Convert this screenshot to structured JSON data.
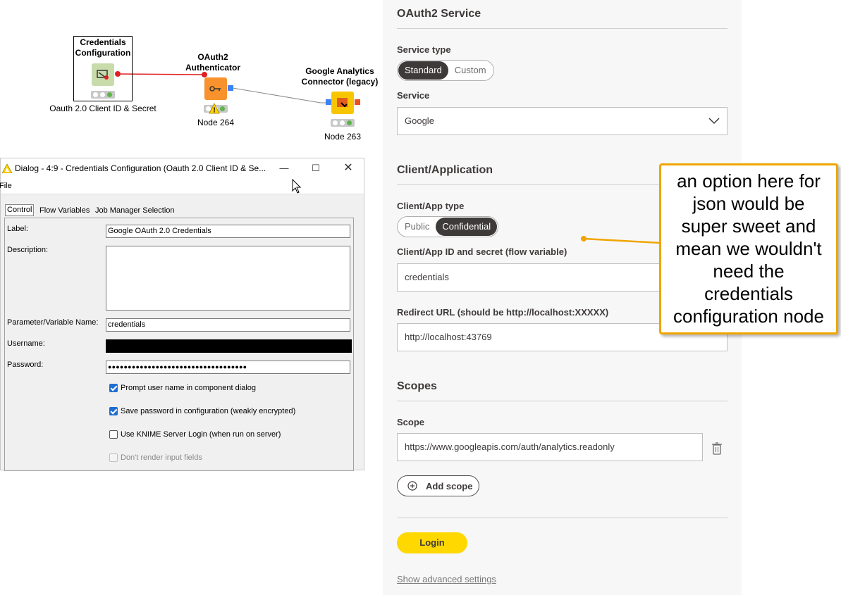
{
  "workflow": {
    "nodes": [
      {
        "title_lines": [
          "Credentials",
          "Configuration"
        ],
        "caption": "Oauth 2.0 Client ID & Secret",
        "icon": "credentials-icon",
        "color": "#c7dcaa"
      },
      {
        "title_lines": [
          "OAuth2",
          "Authenticator"
        ],
        "caption": "Node 264",
        "icon": "key-icon",
        "color": "#f7922c",
        "warning": true
      },
      {
        "title_lines": [
          "Google Analytics",
          "Connector (legacy)"
        ],
        "caption": "Node 263",
        "icon": "analytics-connector-icon",
        "color": "#f7c600"
      }
    ]
  },
  "dialog": {
    "title": "Dialog - 4:9 - Credentials Configuration (Oauth 2.0 Client ID & Se...",
    "menu": [
      "File"
    ],
    "tabs": [
      "Control",
      "Flow Variables",
      "Job Manager Selection"
    ],
    "active_tab": "Control",
    "fields": {
      "label": {
        "label": "Label:",
        "value": "Google OAuth 2.0 Credentials"
      },
      "description": {
        "label": "Description:",
        "value": ""
      },
      "parameter": {
        "label": "Parameter/Variable Name:",
        "value": "credentials"
      },
      "username": {
        "label": "Username:",
        "value": ""
      },
      "password": {
        "label": "Password:",
        "value": "●●●●●●●●●●●●●●●●●●●●●●●●●●●●●●●●●●●"
      }
    },
    "checkboxes": [
      {
        "label": "Prompt user name in component dialog",
        "checked": true
      },
      {
        "label": "Save password in configuration (weakly encrypted)",
        "checked": true
      },
      {
        "label": "Use KNIME Server Login (when run on server)",
        "checked": false
      },
      {
        "label": "Don't render input fields",
        "checked": false,
        "disabled": true
      }
    ]
  },
  "config": {
    "oauth_section_title": "OAuth2 Service",
    "service_type": {
      "label": "Service type",
      "options": [
        "Standard",
        "Custom"
      ],
      "selected": "Standard"
    },
    "service": {
      "label": "Service",
      "value": "Google"
    },
    "client_section_title": "Client/Application",
    "client_type": {
      "label": "Client/App type",
      "options": [
        "Public",
        "Confidential"
      ],
      "selected": "Confidential"
    },
    "client_id": {
      "label": "Client/App ID and secret (flow variable)",
      "value": "credentials"
    },
    "redirect": {
      "label": "Redirect URL (should be http://localhost:XXXXX)",
      "value": "http://localhost:43769"
    },
    "scopes_section_title": "Scopes",
    "scope": {
      "label": "Scope",
      "value": "https://www.googleapis.com/auth/analytics.readonly"
    },
    "add_scope_label": "Add scope",
    "login_label": "Login",
    "advanced_link": "Show advanced settings"
  },
  "callout": {
    "lines": [
      "an  option here for",
      "json would be",
      "super sweet and",
      "mean we wouldn't",
      "need the",
      "credentials",
      "configuration node"
    ],
    "border_color": "#f0a500"
  }
}
